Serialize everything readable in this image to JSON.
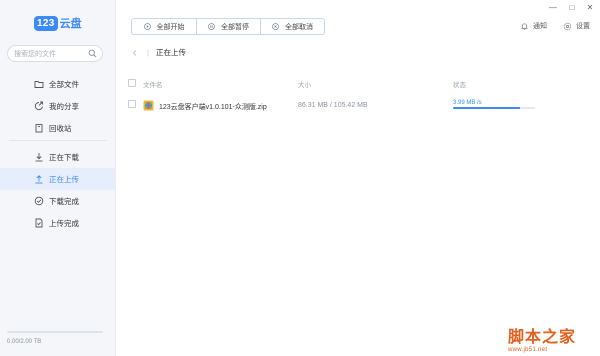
{
  "app": {
    "logo_badge": "123",
    "logo_text": "云盘"
  },
  "search": {
    "placeholder": "搜索您的文件"
  },
  "sidebar": {
    "items": [
      {
        "label": "全部文件",
        "icon": "folder-icon"
      },
      {
        "label": "我的分享",
        "icon": "share-icon"
      },
      {
        "label": "回收站",
        "icon": "trash-icon"
      },
      {
        "label": "正在下载",
        "icon": "download-icon"
      },
      {
        "label": "正在上传",
        "icon": "upload-icon",
        "active": true
      },
      {
        "label": "下载完成",
        "icon": "check-circle-icon"
      },
      {
        "label": "上传完成",
        "icon": "file-done-icon"
      }
    ]
  },
  "storage": {
    "text": "0.00/2.00 TB",
    "used_fraction": 0.0
  },
  "toolbar": {
    "start_all": "全部开始",
    "pause_all": "全部暂停",
    "cancel_all": "全部取消"
  },
  "top_right": {
    "notify": "通知",
    "settings": "设置"
  },
  "window": {
    "minimize": "—",
    "maximize": "□",
    "close": "✕"
  },
  "breadcrumb": {
    "current": "正在上传"
  },
  "table": {
    "headers": {
      "name": "文件名",
      "size": "大小",
      "status": "状态"
    },
    "rows": [
      {
        "name": "123云盘客户端v1.0.101-众测版.zip",
        "size": "86.31 MB / 105.42 MB",
        "speed": "3.99 MB /s",
        "progress": 0.82
      }
    ]
  },
  "watermark": {
    "main": "脚本之家",
    "sub": "www.jb51.net"
  },
  "colors": {
    "accent": "#3d8af7",
    "sidebar_bg": "#f4f6fa",
    "active_bg": "#e6eefc",
    "watermark": "#e0621e"
  }
}
